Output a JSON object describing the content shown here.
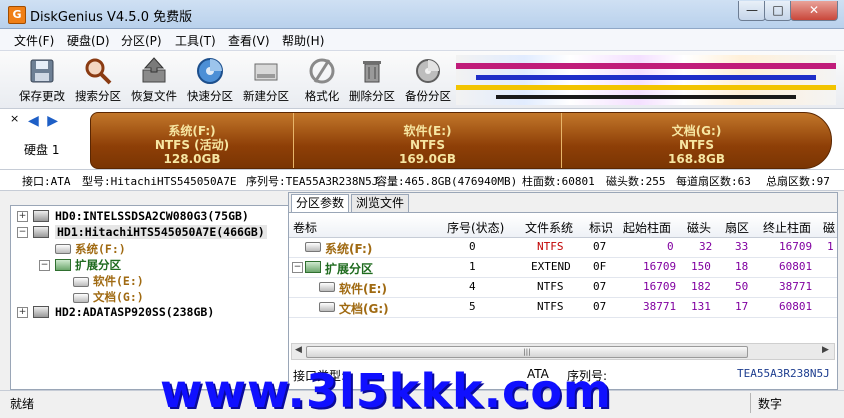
{
  "window": {
    "title": "DiskGenius V4.5.0 免费版",
    "app_icon_letter": "G",
    "min_glyph": "—",
    "max_glyph": "□",
    "close_glyph": "✕"
  },
  "menu": [
    "文件(F)",
    "硬盘(D)",
    "分区(P)",
    "工具(T)",
    "查看(V)",
    "帮助(H)"
  ],
  "toolbar": [
    {
      "label": "保存更改",
      "icon": "save-icon"
    },
    {
      "label": "搜索分区",
      "icon": "magnifier-icon"
    },
    {
      "label": "恢复文件",
      "icon": "restore-icon"
    },
    {
      "label": "快速分区",
      "icon": "quick-partition-icon"
    },
    {
      "label": "新建分区",
      "icon": "new-partition-icon"
    },
    {
      "label": "格式化",
      "icon": "format-icon"
    },
    {
      "label": "删除分区",
      "icon": "delete-icon"
    },
    {
      "label": "备份分区",
      "icon": "backup-icon"
    }
  ],
  "disk_panel": {
    "close_glyph": "×",
    "nav": "◀ ▶",
    "disk_label": "硬盘 1",
    "partitions": [
      {
        "name": "系统(F:)",
        "fs": "NTFS (活动)",
        "size": "128.0GB",
        "share": 128.0
      },
      {
        "name": "软件(E:)",
        "fs": "NTFS",
        "size": "169.0GB",
        "share": 169.0
      },
      {
        "name": "文档(G:)",
        "fs": "NTFS",
        "size": "168.8GB",
        "share": 168.8
      }
    ]
  },
  "disk_info": {
    "interface": "接口:ATA",
    "model": "型号:HitachiHTS545050A7E",
    "serial": "序列号:TEA55A3R238N5J",
    "capacity": "容量:465.8GB(476940MB)",
    "cylinders": "柱面数:60801",
    "heads": "磁头数:255",
    "sectors_per_track": "每道扇区数:63",
    "total_sectors": "总扇区数:97"
  },
  "tree": {
    "hd0": "HD0:INTELSSDSA2CW080G3(75GB)",
    "hd1": "HD1:HitachiHTS545050A7E(466GB)",
    "part_sys": "系统(F:)",
    "part_ext": "扩展分区",
    "part_soft": "软件(E:)",
    "part_doc": "文档(G:)",
    "hd2": "HD2:ADATASP920SS(238GB)",
    "expand": "+",
    "collapse": "−"
  },
  "tabs": [
    "分区参数",
    "浏览文件"
  ],
  "table": {
    "headers": [
      "卷标",
      "序号(状态)",
      "文件系统",
      "标识",
      "起始柱面",
      "磁头",
      "扇区",
      "终止柱面",
      "磁"
    ],
    "rows": [
      {
        "name": "系统(F:)",
        "index": "0",
        "fs": "NTFS",
        "id": "07",
        "start_cyl": "0",
        "head": "32",
        "sector": "33",
        "end_cyl": "16709",
        "extra": "1"
      },
      {
        "name": "扩展分区",
        "index": "1",
        "fs": "EXTEND",
        "id": "0F",
        "start_cyl": "16709",
        "head": "150",
        "sector": "18",
        "end_cyl": "60801",
        "extra": ""
      },
      {
        "name": "软件(E:)",
        "index": "4",
        "fs": "NTFS",
        "id": "07",
        "start_cyl": "16709",
        "head": "182",
        "sector": "50",
        "end_cyl": "38771",
        "extra": ""
      },
      {
        "name": "文档(G:)",
        "index": "5",
        "fs": "NTFS",
        "id": "07",
        "start_cyl": "38771",
        "head": "131",
        "sector": "17",
        "end_cyl": "60801",
        "extra": ""
      }
    ]
  },
  "scroll": {
    "left": "◀",
    "right": "▶",
    "grip": "|||"
  },
  "detail": {
    "interface_label": "接口类型:",
    "interface_value": "ATA",
    "serial_label": "序列号:",
    "serial_value": "TEA55A3R238N5J"
  },
  "status": {
    "left": "就绪",
    "right": "数字"
  },
  "watermark": "www.3l5kkk.com",
  "colors": {
    "partition_bar": "#8e3f07",
    "partition_text": "#f6e6a2",
    "red_fs": "#c00000",
    "purple_num": "#8000a0",
    "watermark": "#1010ff"
  }
}
